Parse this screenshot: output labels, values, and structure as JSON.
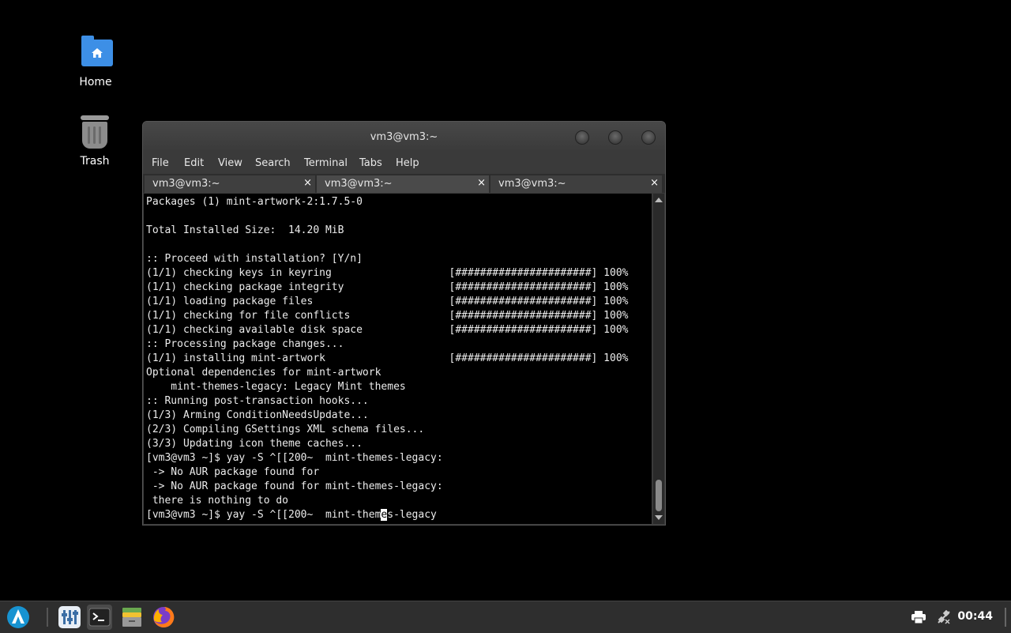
{
  "desktop": {
    "icons": [
      {
        "label": "Home"
      },
      {
        "label": "Trash"
      }
    ]
  },
  "window": {
    "title": "vm3@vm3:~",
    "menu": [
      "File",
      "Edit",
      "View",
      "Search",
      "Terminal",
      "Tabs",
      "Help"
    ],
    "tabs": [
      {
        "label": "vm3@vm3:~",
        "close": "×"
      },
      {
        "label": "vm3@vm3:~",
        "close": "×"
      },
      {
        "label": "vm3@vm3:~",
        "close": "×"
      }
    ],
    "active_tab": 1,
    "terminal_lines": [
      "Packages (1) mint-artwork-2:1.7.5-0",
      "",
      "Total Installed Size:  14.20 MiB",
      "",
      ":: Proceed with installation? [Y/n]",
      "(1/1) checking keys in keyring                   [######################] 100%",
      "(1/1) checking package integrity                 [######################] 100%",
      "(1/1) loading package files                      [######################] 100%",
      "(1/1) checking for file conflicts                [######################] 100%",
      "(1/1) checking available disk space              [######################] 100%",
      ":: Processing package changes...",
      "(1/1) installing mint-artwork                    [######################] 100%",
      "Optional dependencies for mint-artwork",
      "    mint-themes-legacy: Legacy Mint themes",
      ":: Running post-transaction hooks...",
      "(1/3) Arming ConditionNeedsUpdate...",
      "(2/3) Compiling GSettings XML schema files...",
      "(3/3) Updating icon theme caches...",
      "[vm3@vm3 ~]$ yay -S ^[[200~  mint-themes-legacy:",
      " -> No AUR package found for",
      " -> No AUR package found for mint-themes-legacy:",
      " there is nothing to do"
    ],
    "prompt_before_cursor": "[vm3@vm3 ~]$ yay -S ^[[200~  mint-them",
    "cursor_char": "e",
    "prompt_after_cursor": "s-legacy"
  },
  "taskbar": {
    "items": [
      {
        "icon": "app-launcher-icon"
      },
      {
        "icon": "settings-manager-icon"
      },
      {
        "icon": "terminal-icon",
        "active": true
      },
      {
        "icon": "file-manager-icon"
      },
      {
        "icon": "firefox-icon"
      }
    ],
    "tray": [
      {
        "icon": "printer-icon"
      },
      {
        "icon": "network-icon"
      }
    ],
    "clock": "00:44"
  },
  "colors": {
    "accent": "#3d8fe6",
    "terminal_bg": "#000000",
    "terminal_fg": "#ececec"
  }
}
